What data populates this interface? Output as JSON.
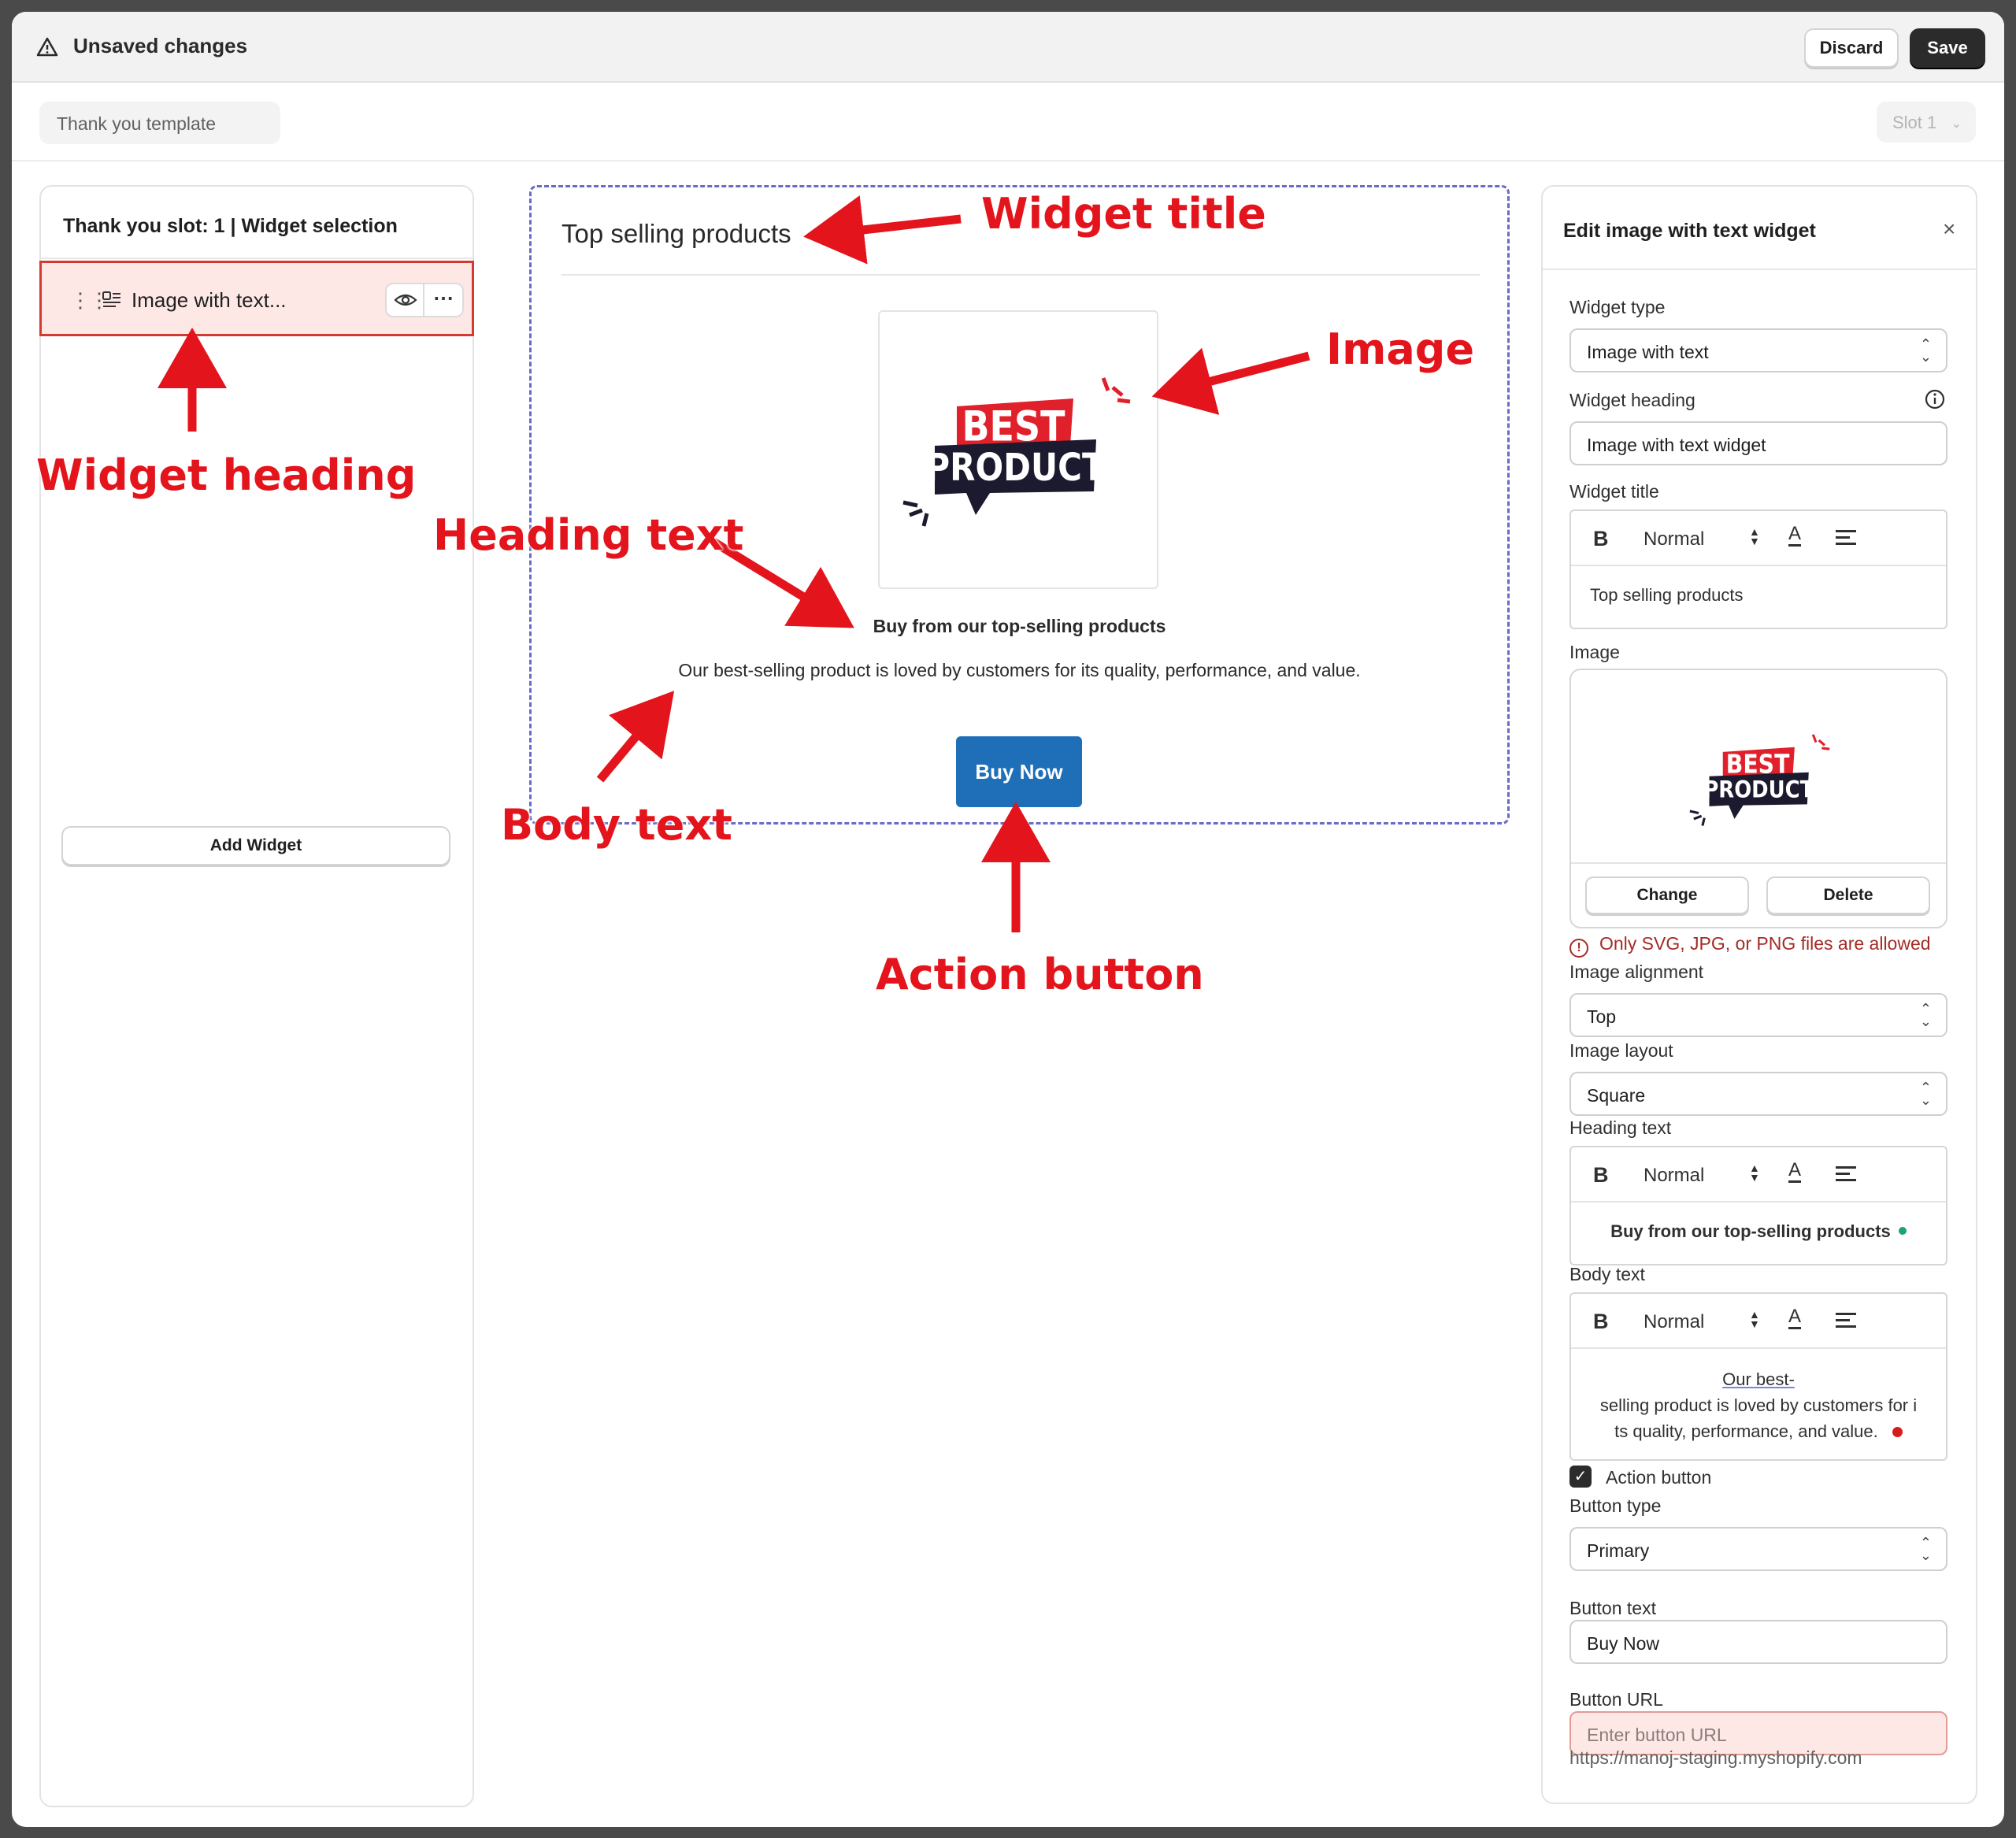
{
  "topbar": {
    "title": "Unsaved changes",
    "discard_label": "Discard",
    "save_label": "Save",
    "warning_icon": "warning-triangle-icon"
  },
  "subbar": {
    "template_name": "Thank you template",
    "slot_label": "Slot 1"
  },
  "left_panel": {
    "title": "Thank you slot: 1 | Widget selection",
    "widget_label": "Image with text...",
    "add_widget_label": "Add Widget"
  },
  "preview": {
    "title": "Top selling products",
    "heading": "Buy from our top-selling products",
    "body": "Our best-selling product is loved by customers for its quality, performance, and value.",
    "button_label": "Buy Now",
    "image_text_top": "BEST",
    "image_text_bottom": "PRODUCT"
  },
  "edit_panel": {
    "title": "Edit image with text widget",
    "widget_type_label": "Widget type",
    "widget_type_value": "Image with text",
    "widget_heading_label": "Widget heading",
    "widget_heading_value": "Image with text widget",
    "widget_title_label": "Widget title",
    "widget_title_value": "Top selling products",
    "format_bold": "B",
    "format_normal": "Normal",
    "format_color": "A",
    "image_label": "Image",
    "change_label": "Change",
    "delete_label": "Delete",
    "image_error": "Only SVG, JPG, or PNG files are allowed",
    "image_alignment_label": "Image alignment",
    "image_alignment_value": "Top",
    "image_layout_label": "Image layout",
    "image_layout_value": "Square",
    "heading_text_label": "Heading text",
    "heading_text_value": "Buy from our top-selling products",
    "body_text_label": "Body text",
    "body_text_line1": "Our best-",
    "body_text_line2": "selling product is loved by customers for i",
    "body_text_line3": "ts quality, performance, and value.",
    "action_button_label": "Action button",
    "action_button_checked": true,
    "button_type_label": "Button type",
    "button_type_value": "Primary",
    "button_text_label": "Button text",
    "button_text_value": "Buy Now",
    "button_url_label": "Button URL",
    "button_url_placeholder": "Enter button URL",
    "store_url": "https://manoj-staging.myshopify.com"
  },
  "annotations": {
    "widget_title": "Widget title",
    "image": "Image",
    "widget_heading": "Widget heading",
    "heading_text": "Heading text",
    "body_text": "Body text",
    "action_button": "Action button"
  },
  "colors": {
    "primary_button": "#1f6fb8",
    "annotation_red": "#e3141c",
    "selected_bg": "#fde8e6",
    "dashed_border": "#6a6ac8"
  }
}
